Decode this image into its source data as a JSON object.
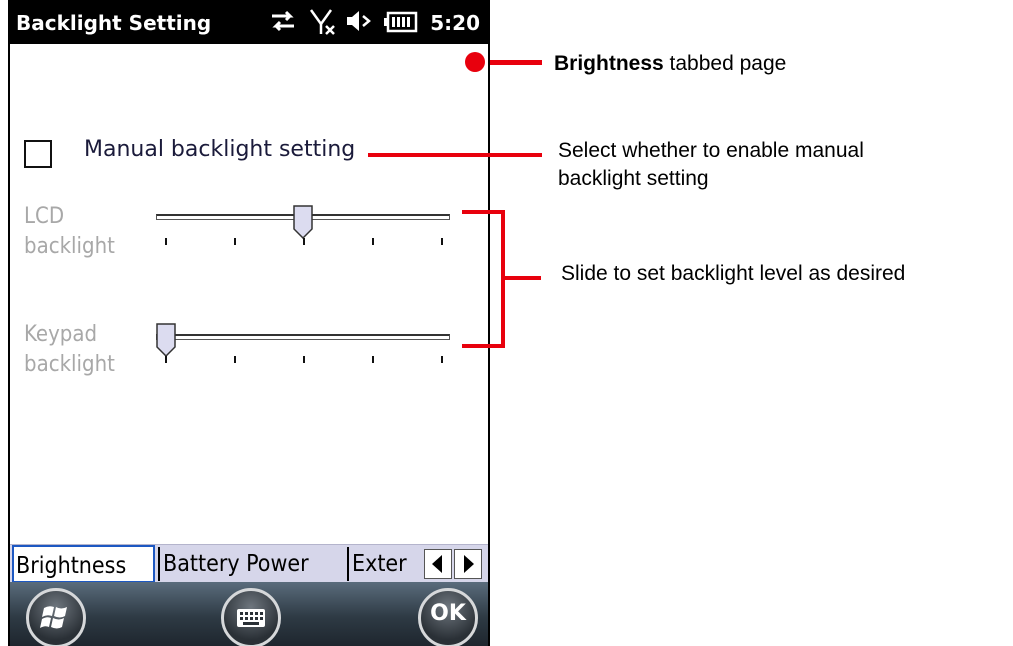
{
  "status_bar": {
    "title": "Backlight Setting",
    "time": "5:20",
    "icons": [
      "data-sync-icon",
      "no-signal-icon",
      "speaker-muted-icon",
      "battery-icon"
    ]
  },
  "settings": {
    "manual_checkbox": {
      "label": "Manual backlight setting",
      "checked": false
    },
    "lcd_slider": {
      "label_line1": "LCD",
      "label_line2": "backlight",
      "level_fraction": 0.5,
      "tick_count": 5
    },
    "keypad_slider": {
      "label_line1": "Keypad",
      "label_line2": "backlight",
      "level_fraction": 0.0,
      "tick_count": 5
    }
  },
  "tabs": {
    "items": [
      "Brightness",
      "Battery Power",
      "Exter"
    ],
    "active": "Brightness",
    "prev_icon": "left-triangle-icon",
    "next_icon": "right-triangle-icon"
  },
  "softkeys": {
    "left_icon": "windows-start-icon",
    "center_icon": "keyboard-icon",
    "right_label": "OK"
  },
  "annotations": {
    "tab_bold": "Brightness",
    "tab_rest": "tabbed page",
    "checkbox_line1": "Select whether to enable manual",
    "checkbox_line2": "backlight setting",
    "slider": "Slide to set backlight level as desired",
    "line_color": "#e8000d"
  }
}
